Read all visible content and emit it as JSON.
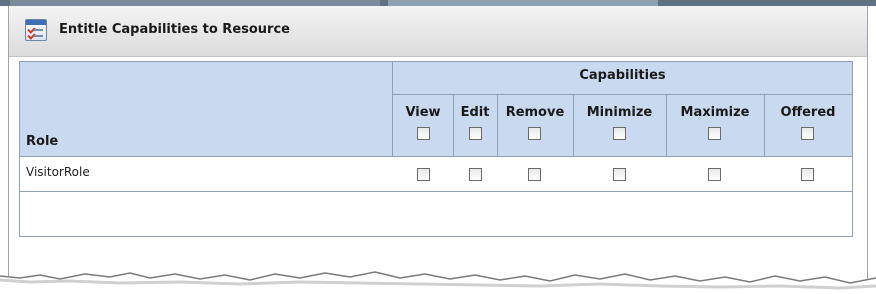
{
  "panel": {
    "title": "Entitle Capabilities to Resource",
    "icon": "checklist-icon"
  },
  "table": {
    "group_header": "Capabilities",
    "role_header": "Role",
    "columns": [
      {
        "key": "view",
        "label": "View",
        "checked": false
      },
      {
        "key": "edit",
        "label": "Edit",
        "checked": false
      },
      {
        "key": "remove",
        "label": "Remove",
        "checked": false
      },
      {
        "key": "minimize",
        "label": "Minimize",
        "checked": false
      },
      {
        "key": "maximize",
        "label": "Maximize",
        "checked": false
      },
      {
        "key": "offered",
        "label": "Offered",
        "checked": false
      }
    ],
    "rows": [
      {
        "role": "VisitorRole",
        "view": false,
        "edit": false,
        "remove": false,
        "minimize": false,
        "maximize": false,
        "offered": false
      }
    ]
  }
}
